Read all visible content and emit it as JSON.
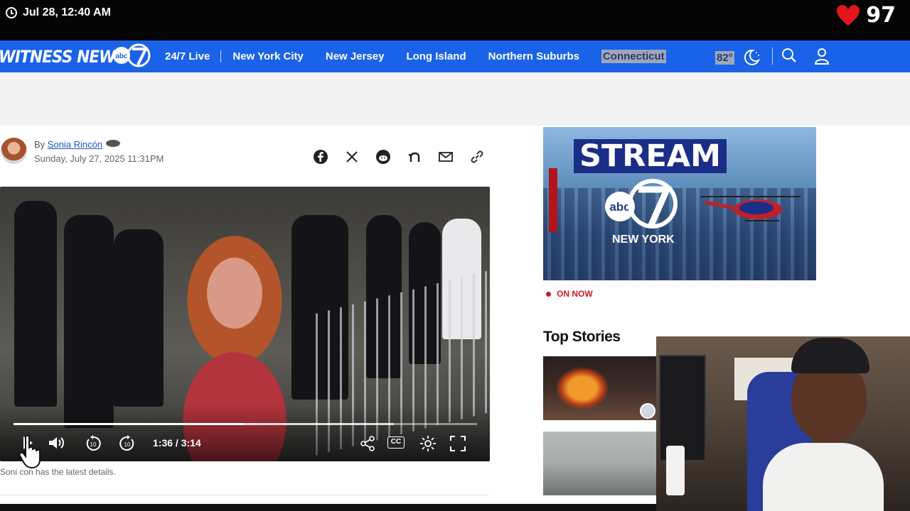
{
  "overlay": {
    "timestamp": "Jul 28, 12:40 AM",
    "heart_rate": "97",
    "heart_color": "#e3161b"
  },
  "nav": {
    "brand": "WITNESS NEWS",
    "links": [
      "24/7 Live",
      "New York City",
      "New Jersey",
      "Long Island",
      "Northern Suburbs",
      "Connecticut"
    ],
    "temperature": "82°",
    "accent": "#1a62e8"
  },
  "article": {
    "by_prefix": "By",
    "author": "Sonia Rincón",
    "date": "Sunday, July 27, 2025 11:31PM",
    "share_icons": [
      "facebook-icon",
      "x-icon",
      "reddit-icon",
      "nextdoor-icon",
      "email-icon",
      "link-icon"
    ],
    "caption": "Soni        con has the latest details."
  },
  "video": {
    "current_time": "1:36",
    "duration": "/ 3:14",
    "progress_fraction": 0.495,
    "buffered_fraction": 0.82,
    "cc_label": "CC"
  },
  "sidebar": {
    "banner_title": "STREAM",
    "banner_subtitle": "NEW YORK",
    "on_now": "ON NOW",
    "top_stories": "Top Stories"
  }
}
